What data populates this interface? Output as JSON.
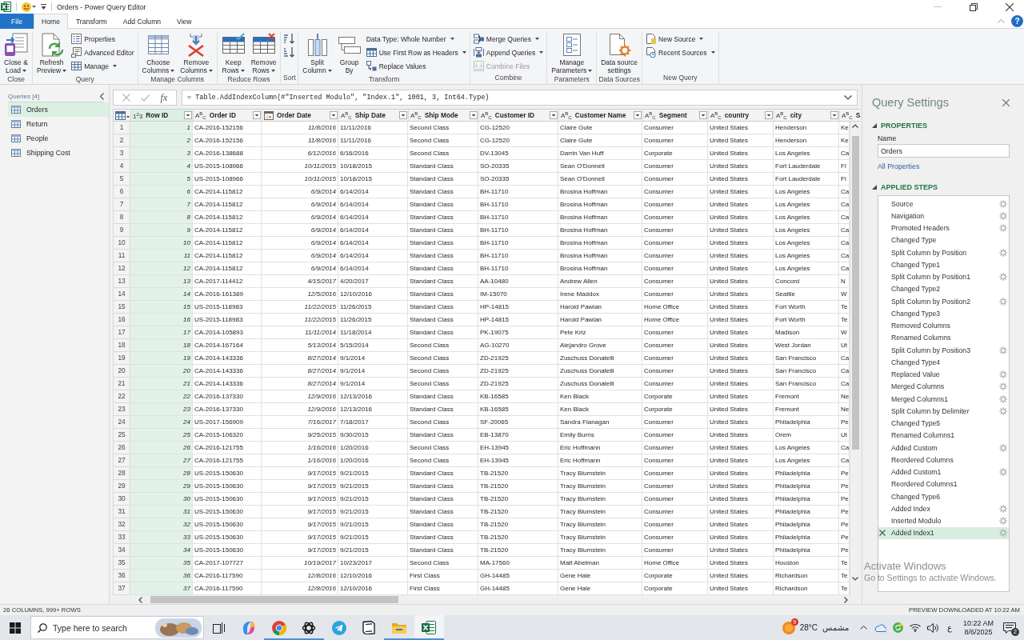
{
  "window": {
    "title": "Orders - Power Query Editor"
  },
  "ribbon": {
    "tabs": [
      {
        "label": "File",
        "kind": "file",
        "selected": false
      },
      {
        "label": "Home",
        "kind": "tab",
        "selected": true
      },
      {
        "label": "Transform",
        "kind": "tab",
        "selected": false
      },
      {
        "label": "Add Column",
        "kind": "tab",
        "selected": false
      },
      {
        "label": "View",
        "kind": "tab",
        "selected": false
      }
    ],
    "help_label": "?",
    "groups": [
      {
        "label": "Close",
        "items": [
          {
            "kind": "large",
            "label": "Close &\nLoad",
            "dropdown": true,
            "disabled": false
          }
        ]
      },
      {
        "label": "Query",
        "items": [
          {
            "kind": "large",
            "label": "Refresh\nPreview",
            "dropdown": true,
            "disabled": false
          },
          {
            "kind": "small",
            "label": "Properties",
            "dropdown": false,
            "disabled": false
          },
          {
            "kind": "small",
            "label": "Advanced Editor",
            "dropdown": false,
            "disabled": false
          },
          {
            "kind": "small",
            "label": "Manage",
            "dropdown": true,
            "disabled": false
          }
        ]
      },
      {
        "label": "Manage Columns",
        "items": [
          {
            "kind": "large",
            "label": "Choose\nColumns",
            "dropdown": true,
            "disabled": false
          },
          {
            "kind": "large",
            "label": "Remove\nColumns",
            "dropdown": true,
            "disabled": false
          }
        ]
      },
      {
        "label": "Reduce Rows",
        "items": [
          {
            "kind": "large",
            "label": "Keep\nRows",
            "dropdown": true,
            "disabled": false
          },
          {
            "kind": "large",
            "label": "Remove\nRows",
            "dropdown": true,
            "disabled": false
          }
        ]
      },
      {
        "label": "Sort",
        "items": [
          {
            "kind": "small",
            "dropdown": false,
            "disabled": false
          },
          {
            "kind": "small",
            "dropdown": false,
            "disabled": false
          }
        ]
      },
      {
        "label": "Transform",
        "items": [
          {
            "kind": "large",
            "label": "Split\nColumn",
            "dropdown": true,
            "disabled": false
          },
          {
            "kind": "large",
            "label": "Group\nBy",
            "dropdown": false,
            "disabled": false
          },
          {
            "kind": "small",
            "label": "Data Type: Whole Number",
            "dropdown": true,
            "disabled": false
          },
          {
            "kind": "small",
            "label": "Use First Row as Headers",
            "dropdown": true,
            "disabled": false
          },
          {
            "kind": "small",
            "label": "Replace Values",
            "dropdown": false,
            "disabled": false
          }
        ]
      },
      {
        "label": "Combine",
        "items": [
          {
            "kind": "small",
            "label": "Merge Queries",
            "dropdown": true,
            "disabled": false
          },
          {
            "kind": "small",
            "label": "Append Queries",
            "dropdown": true,
            "disabled": false
          },
          {
            "kind": "small",
            "label": "Combine Files",
            "dropdown": false,
            "disabled": true
          }
        ]
      },
      {
        "label": "Parameters",
        "items": [
          {
            "kind": "large",
            "label": "Manage\nParameters",
            "dropdown": true,
            "disabled": false
          }
        ]
      },
      {
        "label": "Data Sources",
        "items": [
          {
            "kind": "large",
            "label": "Data source\nsettings",
            "dropdown": false,
            "disabled": false
          }
        ]
      },
      {
        "label": "New Query",
        "items": [
          {
            "kind": "small",
            "label": "New Source",
            "dropdown": true,
            "disabled": false
          },
          {
            "kind": "small",
            "label": "Recent Sources",
            "dropdown": true,
            "disabled": false
          }
        ]
      }
    ]
  },
  "queries": {
    "title": "Queries [4]",
    "items": [
      {
        "label": "Orders",
        "selected": true
      },
      {
        "label": "Return",
        "selected": false
      },
      {
        "label": "People",
        "selected": false
      },
      {
        "label": "Shipping Cost",
        "selected": false
      }
    ]
  },
  "formula_bar": {
    "fx_label": "fx",
    "formula": "= Table.AddIndexColumn(#\"Inserted Modulo\", \"Index.1\", 1001, 3, Int64.Type)"
  },
  "table": {
    "columns": [
      {
        "name": "Row ID",
        "kind": "number",
        "type_label": "1$^{2}$3",
        "selected": true,
        "filter": true
      },
      {
        "name": "Order ID",
        "kind": "text",
        "type_label": "A$^{B}$$_{C}$",
        "selected": false,
        "filter": true
      },
      {
        "name": "Order Date",
        "kind": "date",
        "selected": false,
        "filter": true
      },
      {
        "name": "Ship Date",
        "kind": "text",
        "type_label": "A$^{B}$$_{C}$",
        "selected": false,
        "filter": true
      },
      {
        "name": "Ship Mode",
        "kind": "text",
        "type_label": "A$^{B}$$_{C}$",
        "selected": false,
        "filter": true
      },
      {
        "name": "Customer ID",
        "kind": "text",
        "type_label": "A$^{B}$$_{C}$",
        "selected": false,
        "filter": true
      },
      {
        "name": "Customer Name",
        "kind": "text",
        "type_label": "A$^{B}$$_{C}$",
        "selected": false,
        "filter": true
      },
      {
        "name": "Segment",
        "kind": "text",
        "type_label": "A$^{B}$$_{C}$",
        "selected": false,
        "filter": true
      },
      {
        "name": "country",
        "kind": "text",
        "type_label": "A$^{B}$$_{C}$",
        "selected": false,
        "filter": true
      },
      {
        "name": "city",
        "kind": "text",
        "type_label": "A$^{B}$$_{C}$",
        "selected": false,
        "filter": true
      },
      {
        "name": "S",
        "kind": "text",
        "type_label": "A$^{B}$$_{C}$",
        "selected": false,
        "filter": false
      }
    ],
    "rows": [
      {
        "row_number": "1",
        "cells": [
          "1",
          "CA-2016-152156",
          "11/8/2016",
          "11/11/2016",
          "Second Class",
          "CG-12520",
          "Claire Gute",
          "Consumer",
          "United States",
          "Henderson",
          "Ke"
        ]
      },
      {
        "row_number": "2",
        "cells": [
          "2",
          "CA-2016-152156",
          "11/8/2016",
          "11/11/2016",
          "Second Class",
          "CG-12520",
          "Claire Gute",
          "Consumer",
          "United States",
          "Henderson",
          "Ke"
        ]
      },
      {
        "row_number": "3",
        "cells": [
          "3",
          "CA-2016-138688",
          "6/12/2016",
          "6/16/2016",
          "Second Class",
          "DV-13045",
          "Darrin Van Huff",
          "Corporate",
          "United States",
          "Los Angeles",
          "Ca"
        ]
      },
      {
        "row_number": "4",
        "cells": [
          "4",
          "US-2015-108966",
          "10/11/2015",
          "10/18/2015",
          "Standard Class",
          "SO-20335",
          "Sean O'Donnell",
          "Consumer",
          "United States",
          "Fort Lauderdale",
          "Fl"
        ]
      },
      {
        "row_number": "5",
        "cells": [
          "5",
          "US-2015-108966",
          "10/11/2015",
          "10/18/2015",
          "Standard Class",
          "SO-20335",
          "Sean O'Donnell",
          "Consumer",
          "United States",
          "Fort Lauderdale",
          "Fl"
        ]
      },
      {
        "row_number": "6",
        "cells": [
          "6",
          "CA-2014-115812",
          "6/9/2014",
          "6/14/2014",
          "Standard Class",
          "BH-11710",
          "Brosina Hoffman",
          "Consumer",
          "United States",
          "Los Angeles",
          "Ca"
        ]
      },
      {
        "row_number": "7",
        "cells": [
          "7",
          "CA-2014-115812",
          "6/9/2014",
          "6/14/2014",
          "Standard Class",
          "BH-11710",
          "Brosina Hoffman",
          "Consumer",
          "United States",
          "Los Angeles",
          "Ca"
        ]
      },
      {
        "row_number": "8",
        "cells": [
          "8",
          "CA-2014-115812",
          "6/9/2014",
          "6/14/2014",
          "Standard Class",
          "BH-11710",
          "Brosina Hoffman",
          "Consumer",
          "United States",
          "Los Angeles",
          "Ca"
        ]
      },
      {
        "row_number": "9",
        "cells": [
          "9",
          "CA-2014-115812",
          "6/9/2014",
          "6/14/2014",
          "Standard Class",
          "BH-11710",
          "Brosina Hoffman",
          "Consumer",
          "United States",
          "Los Angeles",
          "Ca"
        ]
      },
      {
        "row_number": "10",
        "cells": [
          "10",
          "CA-2014-115812",
          "6/9/2014",
          "6/14/2014",
          "Standard Class",
          "BH-11710",
          "Brosina Hoffman",
          "Consumer",
          "United States",
          "Los Angeles",
          "Ca"
        ]
      },
      {
        "row_number": "11",
        "cells": [
          "11",
          "CA-2014-115812",
          "6/9/2014",
          "6/14/2014",
          "Standard Class",
          "BH-11710",
          "Brosina Hoffman",
          "Consumer",
          "United States",
          "Los Angeles",
          "Ca"
        ]
      },
      {
        "row_number": "12",
        "cells": [
          "12",
          "CA-2014-115812",
          "6/9/2014",
          "6/14/2014",
          "Standard Class",
          "BH-11710",
          "Brosina Hoffman",
          "Consumer",
          "United States",
          "Los Angeles",
          "Ca"
        ]
      },
      {
        "row_number": "13",
        "cells": [
          "13",
          "CA-2017-114412",
          "4/15/2017",
          "4/20/2017",
          "Standard Class",
          "AA-10480",
          "Andrew Allen",
          "Consumer",
          "United States",
          "Concord",
          "N"
        ]
      },
      {
        "row_number": "14",
        "cells": [
          "14",
          "CA-2016-161389",
          "12/5/2016",
          "12/10/2016",
          "Standard Class",
          "IM-15070",
          "Irene Maddox",
          "Consumer",
          "United States",
          "Seattle",
          "W"
        ]
      },
      {
        "row_number": "15",
        "cells": [
          "15",
          "US-2015-118983",
          "11/22/2015",
          "11/26/2015",
          "Standard Class",
          "HP-14815",
          "Harold Pawlan",
          "Home Office",
          "United States",
          "Fort Worth",
          "Te"
        ]
      },
      {
        "row_number": "16",
        "cells": [
          "16",
          "US-2015-118983",
          "11/22/2015",
          "11/26/2015",
          "Standard Class",
          "HP-14815",
          "Harold Pawlan",
          "Home Office",
          "United States",
          "Fort Worth",
          "Te"
        ]
      },
      {
        "row_number": "17",
        "cells": [
          "17",
          "CA-2014-105893",
          "11/11/2014",
          "11/18/2014",
          "Standard Class",
          "PK-19075",
          "Pete Kriz",
          "Consumer",
          "United States",
          "Madison",
          "W"
        ]
      },
      {
        "row_number": "18",
        "cells": [
          "18",
          "CA-2014-167164",
          "5/13/2014",
          "5/15/2014",
          "Second Class",
          "AG-10270",
          "Alejandro Grove",
          "Consumer",
          "United States",
          "West Jordan",
          "Ut"
        ]
      },
      {
        "row_number": "19",
        "cells": [
          "19",
          "CA-2014-143336",
          "8/27/2014",
          "9/1/2014",
          "Second Class",
          "ZD-21925",
          "Zuschuss Donatelli",
          "Consumer",
          "United States",
          "San Francisco",
          "Ca"
        ]
      },
      {
        "row_number": "20",
        "cells": [
          "20",
          "CA-2014-143336",
          "8/27/2014",
          "9/1/2014",
          "Second Class",
          "ZD-21925",
          "Zuschuss Donatelli",
          "Consumer",
          "United States",
          "San Francisco",
          "Ca"
        ]
      },
      {
        "row_number": "21",
        "cells": [
          "21",
          "CA-2014-143336",
          "8/27/2014",
          "9/1/2014",
          "Second Class",
          "ZD-21925",
          "Zuschuss Donatelli",
          "Consumer",
          "United States",
          "San Francisco",
          "Ca"
        ]
      },
      {
        "row_number": "22",
        "cells": [
          "22",
          "CA-2016-137330",
          "12/9/2016",
          "12/13/2016",
          "Standard Class",
          "KB-16585",
          "Ken Black",
          "Corporate",
          "United States",
          "Fremont",
          "Ne"
        ]
      },
      {
        "row_number": "23",
        "cells": [
          "23",
          "CA-2016-137330",
          "12/9/2016",
          "12/13/2016",
          "Standard Class",
          "KB-16585",
          "Ken Black",
          "Corporate",
          "United States",
          "Fremont",
          "Ne"
        ]
      },
      {
        "row_number": "24",
        "cells": [
          "24",
          "US-2017-156909",
          "7/16/2017",
          "7/18/2017",
          "Second Class",
          "SF-20065",
          "Sandra Flanagan",
          "Consumer",
          "United States",
          "Philadelphia",
          "Pe"
        ]
      },
      {
        "row_number": "25",
        "cells": [
          "25",
          "CA-2015-106320",
          "9/25/2015",
          "9/30/2015",
          "Standard Class",
          "EB-13870",
          "Emily Burns",
          "Consumer",
          "United States",
          "Orem",
          "Ut"
        ]
      },
      {
        "row_number": "26",
        "cells": [
          "26",
          "CA-2016-121755",
          "1/16/2016",
          "1/20/2016",
          "Second Class",
          "EH-13945",
          "Eric Hoffmann",
          "Consumer",
          "United States",
          "Los Angeles",
          "Ca"
        ]
      },
      {
        "row_number": "27",
        "cells": [
          "27",
          "CA-2016-121755",
          "1/16/2016",
          "1/20/2016",
          "Second Class",
          "EH-13945",
          "Eric Hoffmann",
          "Consumer",
          "United States",
          "Los Angeles",
          "Ca"
        ]
      },
      {
        "row_number": "28",
        "cells": [
          "28",
          "US-2015-150630",
          "9/17/2015",
          "9/21/2015",
          "Standard Class",
          "TB-21520",
          "Tracy Blumstein",
          "Consumer",
          "United States",
          "Philadelphia",
          "Pe"
        ]
      },
      {
        "row_number": "29",
        "cells": [
          "29",
          "US-2015-150630",
          "9/17/2015",
          "9/21/2015",
          "Standard Class",
          "TB-21520",
          "Tracy Blumstein",
          "Consumer",
          "United States",
          "Philadelphia",
          "Pe"
        ]
      },
      {
        "row_number": "30",
        "cells": [
          "30",
          "US-2015-150630",
          "9/17/2015",
          "9/21/2015",
          "Standard Class",
          "TB-21520",
          "Tracy Blumstein",
          "Consumer",
          "United States",
          "Philadelphia",
          "Pe"
        ]
      },
      {
        "row_number": "31",
        "cells": [
          "31",
          "US-2015-150630",
          "9/17/2015",
          "9/21/2015",
          "Standard Class",
          "TB-21520",
          "Tracy Blumstein",
          "Consumer",
          "United States",
          "Philadelphia",
          "Pe"
        ]
      },
      {
        "row_number": "32",
        "cells": [
          "32",
          "US-2015-150630",
          "9/17/2015",
          "9/21/2015",
          "Standard Class",
          "TB-21520",
          "Tracy Blumstein",
          "Consumer",
          "United States",
          "Philadelphia",
          "Pe"
        ]
      },
      {
        "row_number": "33",
        "cells": [
          "33",
          "US-2015-150630",
          "9/17/2015",
          "9/21/2015",
          "Standard Class",
          "TB-21520",
          "Tracy Blumstein",
          "Consumer",
          "United States",
          "Philadelphia",
          "Pe"
        ]
      },
      {
        "row_number": "34",
        "cells": [
          "34",
          "US-2015-150630",
          "9/17/2015",
          "9/21/2015",
          "Standard Class",
          "TB-21520",
          "Tracy Blumstein",
          "Consumer",
          "United States",
          "Philadelphia",
          "Pe"
        ]
      },
      {
        "row_number": "35",
        "cells": [
          "35",
          "CA-2017-107727",
          "10/19/2017",
          "10/23/2017",
          "Second Class",
          "MA-17560",
          "Matt Abelman",
          "Home Office",
          "United States",
          "Houston",
          "Te"
        ]
      },
      {
        "row_number": "36",
        "cells": [
          "36",
          "CA-2016-117590",
          "12/8/2016",
          "12/10/2016",
          "First Class",
          "GH-14485",
          "Gene Hale",
          "Corporate",
          "United States",
          "Richardson",
          "Te"
        ]
      },
      {
        "row_number": "37",
        "cells": [
          "37",
          "CA-2016-117590",
          "12/8/2016",
          "12/10/2016",
          "First Class",
          "GH-14485",
          "Gene Hale",
          "Corporate",
          "United States",
          "Richardson",
          "Te"
        ]
      }
    ]
  },
  "settings": {
    "title": "Query Settings",
    "properties": {
      "heading": "PROPERTIES",
      "expanded": true,
      "name_label": "Name",
      "name_value": "Orders",
      "link": "All Properties"
    },
    "applied_steps": {
      "heading": "APPLIED STEPS",
      "expanded": true,
      "steps": [
        {
          "label": "Source",
          "has_settings": true,
          "selected": false
        },
        {
          "label": "Navigation",
          "has_settings": true,
          "selected": false
        },
        {
          "label": "Promoted Headers",
          "has_settings": true,
          "selected": false
        },
        {
          "label": "Changed Type",
          "has_settings": false,
          "selected": false
        },
        {
          "label": "Split Column by Position",
          "has_settings": true,
          "selected": false
        },
        {
          "label": "Changed Type1",
          "has_settings": false,
          "selected": false
        },
        {
          "label": "Split Column by Position1",
          "has_settings": true,
          "selected": false
        },
        {
          "label": "Changed Type2",
          "has_settings": false,
          "selected": false
        },
        {
          "label": "Split Column by Position2",
          "has_settings": true,
          "selected": false
        },
        {
          "label": "Changed Type3",
          "has_settings": false,
          "selected": false
        },
        {
          "label": "Removed Columns",
          "has_settings": false,
          "selected": false
        },
        {
          "label": "Renamed Columns",
          "has_settings": false,
          "selected": false
        },
        {
          "label": "Split Column by Position3",
          "has_settings": true,
          "selected": false
        },
        {
          "label": "Changed Type4",
          "has_settings": false,
          "selected": false
        },
        {
          "label": "Replaced Value",
          "has_settings": true,
          "selected": false
        },
        {
          "label": "Merged Columns",
          "has_settings": true,
          "selected": false
        },
        {
          "label": "Merged Columns1",
          "has_settings": true,
          "selected": false
        },
        {
          "label": "Split Column by Delimiter",
          "has_settings": true,
          "selected": false
        },
        {
          "label": "Changed Type5",
          "has_settings": false,
          "selected": false
        },
        {
          "label": "Renamed Columns1",
          "has_settings": false,
          "selected": false
        },
        {
          "label": "Added Custom",
          "has_settings": true,
          "selected": false
        },
        {
          "label": "Reordered Columns",
          "has_settings": false,
          "selected": false
        },
        {
          "label": "Added Custom1",
          "has_settings": true,
          "selected": false
        },
        {
          "label": "Reordered Columns1",
          "has_settings": false,
          "selected": false
        },
        {
          "label": "Changed Type6",
          "has_settings": false,
          "selected": false
        },
        {
          "label": "Added Index",
          "has_settings": true,
          "selected": false
        },
        {
          "label": "Inserted Modulo",
          "has_settings": true,
          "selected": false
        },
        {
          "label": "Added Index1",
          "has_settings": true,
          "selected": true
        }
      ]
    }
  },
  "status_bar": {
    "left": "26 COLUMNS, 999+ ROWS",
    "right": "PREVIEW DOWNLOADED AT 10:22 AM"
  },
  "activation_notice": {
    "title": "Activate Windows",
    "subtitle": "Go to Settings to activate Windows."
  },
  "taskbar": {
    "search_placeholder": "Type here to search",
    "apps": [
      {
        "running": false,
        "active": false
      },
      {
        "running": true,
        "active": false
      },
      {
        "running": true,
        "active": false
      },
      {
        "running": false,
        "active": false
      },
      {
        "running": false,
        "active": false
      },
      {
        "running": true,
        "active": false
      },
      {
        "running": true,
        "active": true
      }
    ],
    "weather": {
      "badge": "9",
      "temperature": "28°C",
      "condition": "مشمس"
    },
    "language": "ع",
    "time": "10:22 AM",
    "date": "8/6/2025",
    "notification_count": "2"
  }
}
